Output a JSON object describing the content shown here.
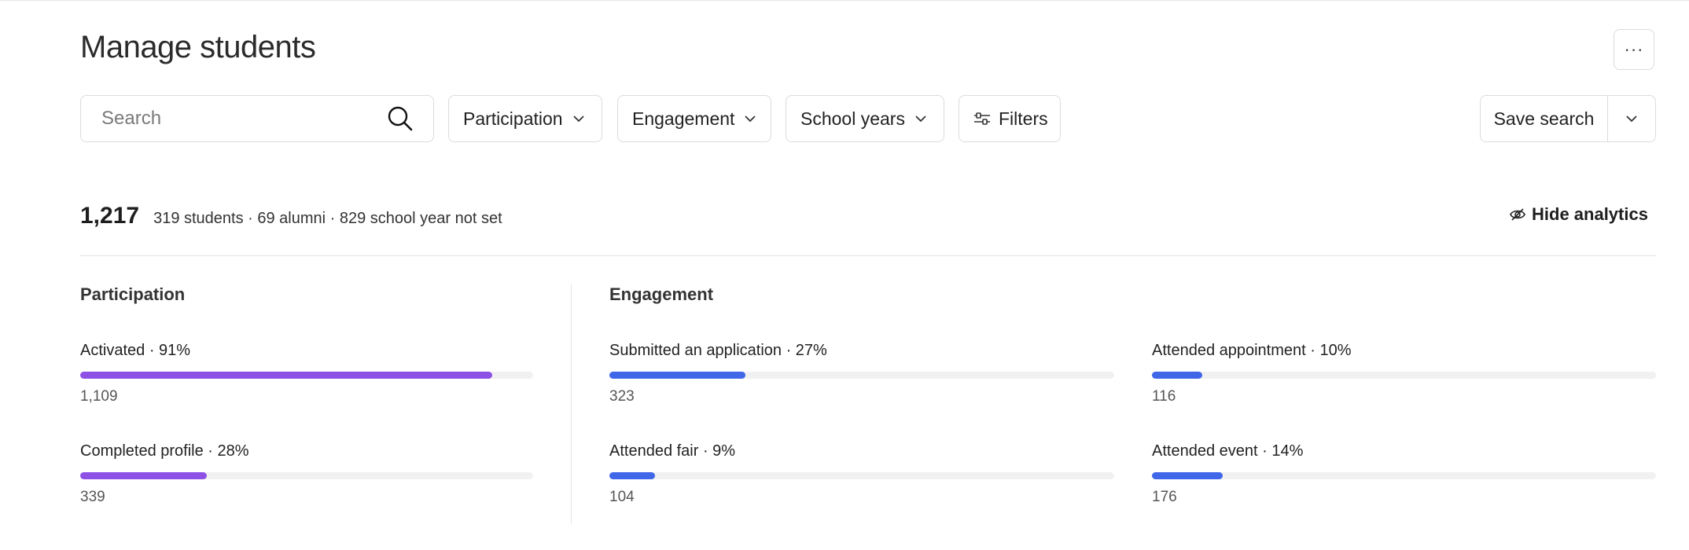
{
  "page": {
    "title": "Manage students",
    "more_label": "···"
  },
  "toolbar": {
    "search_placeholder": "Search",
    "filters": [
      {
        "label": "Participation"
      },
      {
        "label": "Engagement"
      },
      {
        "label": "School years"
      }
    ],
    "filters_button": "Filters",
    "save_search": "Save search"
  },
  "summary": {
    "total": "1,217",
    "breakdown": "319 students · 69 alumni · 829 school year not set",
    "hide_analytics": "Hide analytics"
  },
  "colors": {
    "participation": "#8e51e6",
    "engagement": "#3f67e8"
  },
  "participation": {
    "title": "Participation",
    "metrics": [
      {
        "label": "Activated · 91%",
        "percent": 91,
        "count": "1,109"
      },
      {
        "label": "Completed profile · 28%",
        "percent": 28,
        "count": "339"
      }
    ]
  },
  "engagement": {
    "title": "Engagement",
    "metrics": [
      {
        "label": "Submitted an application · 27%",
        "percent": 27,
        "count": "323"
      },
      {
        "label": "Attended appointment · 10%",
        "percent": 10,
        "count": "116"
      },
      {
        "label": "Attended fair · 9%",
        "percent": 9,
        "count": "104"
      },
      {
        "label": "Attended event · 14%",
        "percent": 14,
        "count": "176"
      }
    ]
  }
}
